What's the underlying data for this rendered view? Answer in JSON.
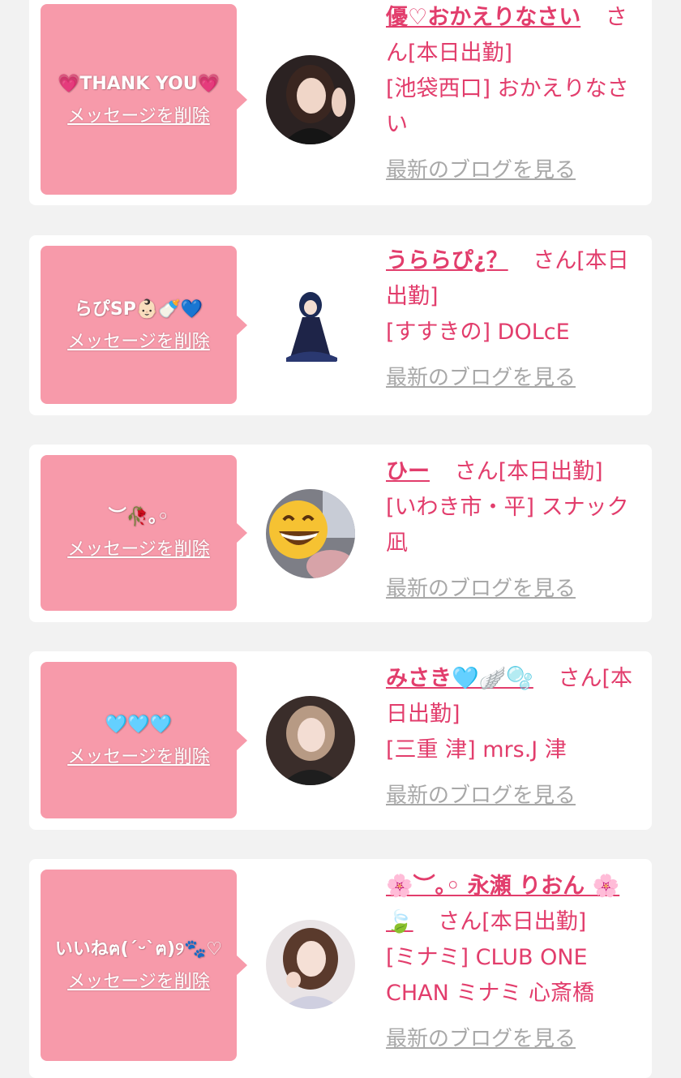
{
  "entries": [
    {
      "message": "💗THANK YOU💗",
      "delete_label": "メッセージを削除",
      "name": "優♡おかえりなさい",
      "suffix": "さん[本日出勤]",
      "shop": "[池袋西口] おかえりなさい",
      "blog_label": "最新のブログを見る"
    },
    {
      "message": "らぴSP👶🏻🍼💙",
      "delete_label": "メッセージを削除",
      "name": "うららぴ¿？",
      "suffix": "さん[本日出勤]",
      "shop": "[すすきの] DOLcE",
      "blog_label": "最新のブログを見る"
    },
    {
      "message": "︶🥀｡◦",
      "delete_label": "メッセージを削除",
      "name": "ひー",
      "suffix": "さん[本日出勤]",
      "shop": "[いわき市・平] スナック凪",
      "blog_label": "最新のブログを見る"
    },
    {
      "message": "🩵🩵🩵",
      "delete_label": "メッセージを削除",
      "name": "みさき🩵🪽🫧",
      "suffix": "さん[本日出勤]",
      "shop": "[三重 津] mrs.J 津",
      "blog_label": "最新のブログを見る"
    },
    {
      "message": "いいねฅ(´ᵕ`ฅ)୨🐾♡",
      "delete_label": "メッセージを削除",
      "name": "🌸︶｡◦ 永瀬 りおん 🌸🍃",
      "suffix": "さん[本日出勤]",
      "shop": "[ミナミ] CLUB ONE CHAN ミナミ 心斎橋",
      "blog_label": "最新のブログを見る"
    }
  ]
}
